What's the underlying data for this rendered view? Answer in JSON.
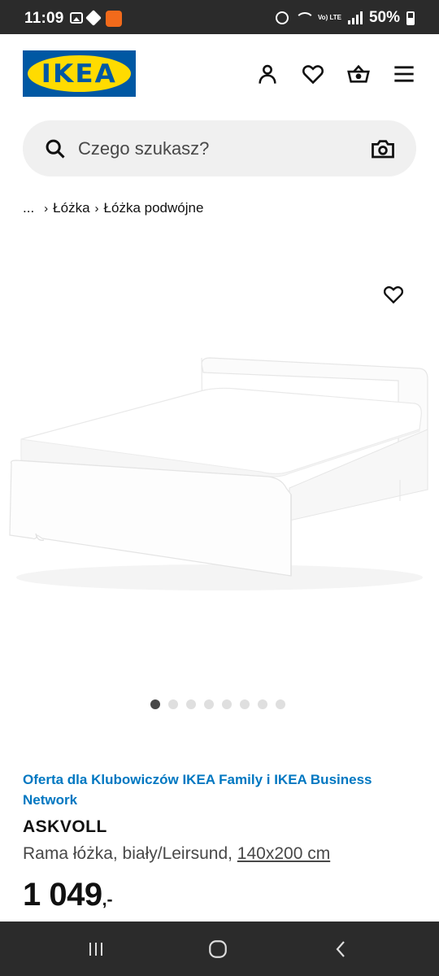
{
  "status_bar": {
    "time": "11:09",
    "battery": "50%",
    "network": "Vo) LTE"
  },
  "header": {
    "logo_text": "IKEA",
    "icons": [
      "account-icon",
      "heart-icon",
      "basket-icon",
      "menu-icon"
    ]
  },
  "search": {
    "placeholder": "Czego szukasz?",
    "value": ""
  },
  "breadcrumb": {
    "ellipsis": "...",
    "items": [
      "Łóżka",
      "Łóżka podwójne"
    ]
  },
  "carousel": {
    "total": 8,
    "active_index": 0
  },
  "product": {
    "family_offer": "Oferta dla Klubowiczów IKEA Family i IKEA Business Network",
    "name": "ASKVOLL",
    "description": "Rama łóżka, biały/Leirsund, ",
    "size": "140x200 cm",
    "price": "1 049",
    "price_suffix": ",-"
  },
  "colors": {
    "ikea_blue": "#0058a3",
    "ikea_yellow": "#ffdb00",
    "offer_link": "#0077c1",
    "search_bg": "#f0f0f0"
  }
}
